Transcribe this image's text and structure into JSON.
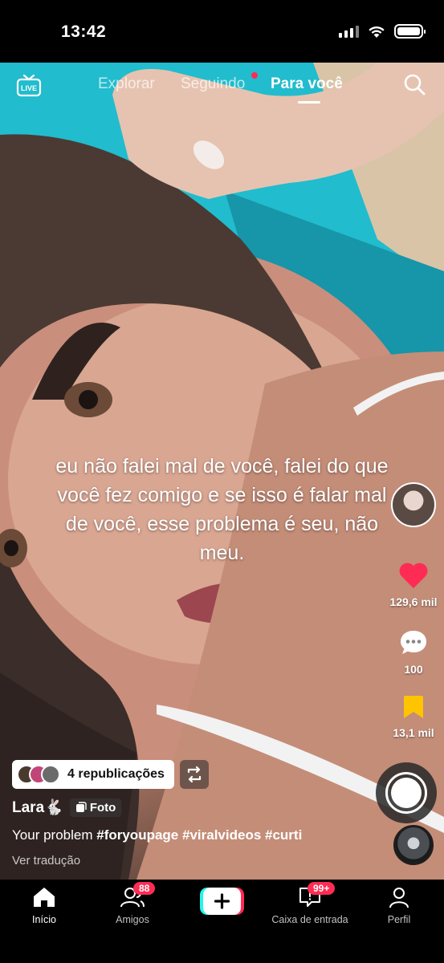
{
  "status_bar": {
    "time": "13:42"
  },
  "top_nav": {
    "live_label": "LIVE",
    "tabs": [
      {
        "label": "Explorar"
      },
      {
        "label": "Seguindo"
      },
      {
        "label": "Para você"
      }
    ]
  },
  "post": {
    "caption": "eu não falei mal de você, falei do que você fez comigo e se isso é falar mal de você, esse problema é seu, não meu.",
    "likes": "129,6 mil",
    "comments": "100",
    "saves": "13,1 mil",
    "reposts_label": "4 republicações",
    "username": "Lara",
    "username_emoji": "🐇",
    "photo_badge": "Foto",
    "description_text": "Your problem",
    "hashtags": [
      "#foryoupage",
      "#viralvideos",
      "#curti"
    ],
    "translate_label": "Ver tradução"
  },
  "bottom_nav": {
    "items": [
      {
        "label": "Início"
      },
      {
        "label": "Amigos",
        "badge": "88"
      },
      {
        "label": ""
      },
      {
        "label": "Caixa de entrada",
        "badge": "99+"
      },
      {
        "label": "Perfil"
      }
    ]
  },
  "colors": {
    "accent": "#fe2c55",
    "bookmark": "#ffc400",
    "brand_cyan": "#25f4ee"
  }
}
